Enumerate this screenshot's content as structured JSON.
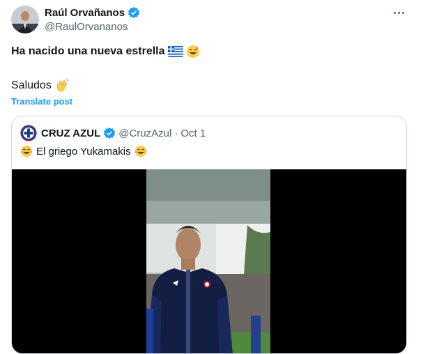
{
  "tweet": {
    "author_name": "Raúl Orvañanos",
    "author_handle": "@RaulOrvananos",
    "text_line1": "Ha nacido una nueva estrella",
    "text_line2": "Saludos",
    "translate_label": "Translate post"
  },
  "quoted": {
    "name": "CRUZ AZUL",
    "handle": "@CruzAzul",
    "separator": "·",
    "date": "Oct 1",
    "text": "El griego Yukamakis"
  },
  "colors": {
    "accent": "#1d9bf0",
    "verified": "#1d9bf0",
    "secondary_text": "#536471",
    "border": "#cfd9de"
  },
  "icons": [
    "verified-badge-icon",
    "more-options-icon",
    "greece-flag-icon",
    "sweat-smile-emoji-icon",
    "waving-hands-emoji-icon",
    "cruz-azul-crest-icon",
    "joy-emoji-icon"
  ]
}
